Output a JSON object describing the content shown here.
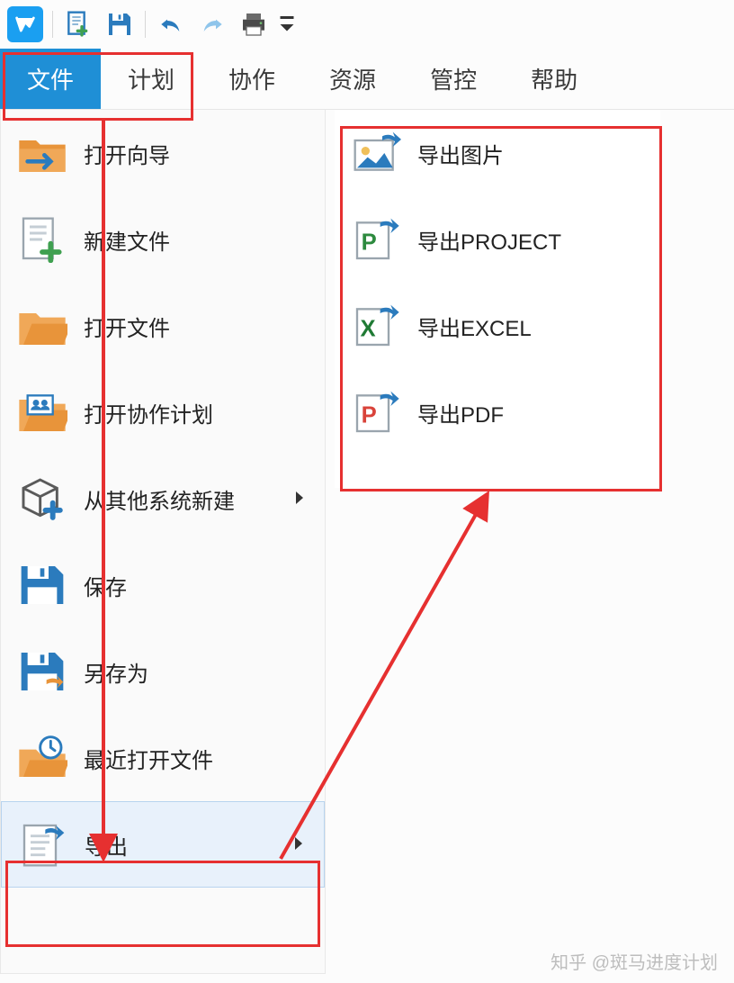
{
  "tabs": {
    "file": "文件",
    "plan": "计划",
    "collab": "协作",
    "resource": "资源",
    "control": "管控",
    "help": "帮助"
  },
  "menu": {
    "open_wizard": "打开向导",
    "new_file": "新建文件",
    "open_file": "打开文件",
    "open_collab_plan": "打开协作计划",
    "new_from_other": "从其他系统新建",
    "save": "保存",
    "save_as": "另存为",
    "recent": "最近打开文件",
    "export": "导出"
  },
  "submenu": {
    "export_image": "导出图片",
    "export_project": "导出PROJECT",
    "export_excel": "导出EXCEL",
    "export_pdf": "导出PDF"
  },
  "watermark": "知乎 @斑马进度计划"
}
